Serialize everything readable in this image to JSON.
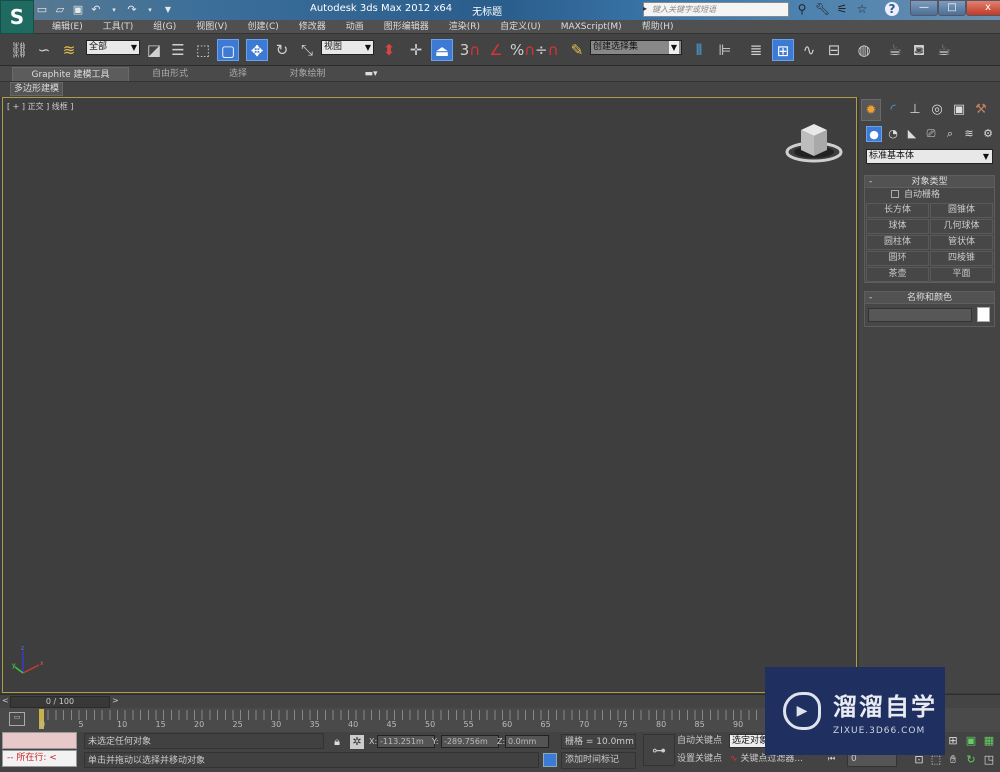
{
  "app": {
    "title": "Autodesk 3ds Max  2012 x64",
    "doc_title": "无标题",
    "logo": "S"
  },
  "quick_access": [
    "new-icon",
    "open-icon",
    "save-icon",
    "undo-icon",
    "redo-icon",
    "customize-icon"
  ],
  "search": {
    "placeholder": "键入关键字或短语"
  },
  "title_icons": [
    "binoculars-icon",
    "wrench-icon",
    "satellite-icon",
    "star-icon",
    "help-icon"
  ],
  "window_buttons": {
    "minimize": "—",
    "maximize": "□",
    "close": "x"
  },
  "menu": [
    "编辑(E)",
    "工具(T)",
    "组(G)",
    "视图(V)",
    "创建(C)",
    "修改器",
    "动画",
    "图形编辑器",
    "渲染(R)",
    "自定义(U)",
    "MAXScript(M)",
    "帮助(H)"
  ],
  "toolbar": {
    "selection_filter": "全部",
    "reference_coord": "视图",
    "named_selection": "创建选择集",
    "snap_labels": {
      "snap3": "3",
      "angle": "%",
      "spinner": "÷"
    }
  },
  "ribbon": {
    "tabs": [
      "Graphite 建模工具",
      "自由形式",
      "选择",
      "对象绘制"
    ],
    "sub_tab": "多边形建模"
  },
  "viewport": {
    "label": "[ + ] 正交 ] 线框 ]"
  },
  "command_panel": {
    "primitive_type": "标准基本体",
    "object_type": {
      "header": "对象类型",
      "auto_grid": "自动栅格",
      "buttons": [
        "长方体",
        "圆锥体",
        "球体",
        "几何球体",
        "圆柱体",
        "管状体",
        "圆环",
        "四棱锥",
        "茶壶",
        "平面"
      ]
    },
    "name_color": {
      "header": "名称和颜色",
      "name_value": "",
      "color": "#ffffff"
    }
  },
  "timeline": {
    "current": "0 / 100",
    "prev": "<",
    "next": ">",
    "tick_labels": [
      "0",
      "5",
      "10",
      "15",
      "20",
      "25",
      "30",
      "35",
      "40",
      "45",
      "50",
      "55",
      "60",
      "65",
      "70",
      "75",
      "80",
      "85",
      "90"
    ]
  },
  "status": {
    "maxscript_label": "所在行:",
    "selection_msg": "未选定任何对象",
    "prompt_msg": "单击并拖动以选择并移动对象",
    "x_label": "X:",
    "x_value": "-113.251m",
    "y_label": "Y:",
    "y_value": "-289.756m",
    "z_label": "Z:",
    "z_value": "0.0mm",
    "grid": "栅格 = 10.0mm",
    "add_time_tag": "添加时间标记",
    "auto_key": "自动关键点",
    "set_key": "设置关键点",
    "selected_dd": "选定对象",
    "key_filters": "关键点过滤器...",
    "current_frame": "0"
  },
  "watermark": {
    "title": "溜溜自学",
    "url": "ZIXUE.3D66.COM"
  },
  "colors": {
    "accent": "#3d7ad4",
    "viewport_border": "#b09b4b",
    "frame_marker": "#c9b24a",
    "watermark_bg": "#1f2f5f"
  }
}
